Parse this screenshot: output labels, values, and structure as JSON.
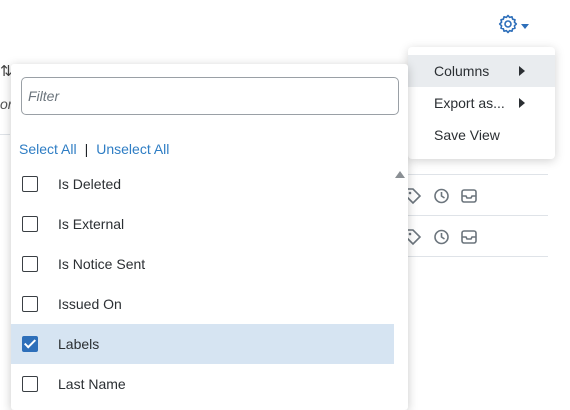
{
  "background": {
    "sort_icon": "⇅",
    "cut_text": "or"
  },
  "gear_button": {
    "icon": "gear-icon"
  },
  "settings_menu": {
    "items": [
      {
        "label": "Columns",
        "has_submenu": true,
        "active": true
      },
      {
        "label": "Export as...",
        "has_submenu": true,
        "active": false
      },
      {
        "label": "Save View",
        "has_submenu": false,
        "active": false
      }
    ]
  },
  "columns_panel": {
    "filter_placeholder": "Filter",
    "filter_value": "",
    "select_all_label": "Select All",
    "separator": "|",
    "unselect_all_label": "Unselect All",
    "columns": [
      {
        "label": "Is Deleted",
        "checked": false
      },
      {
        "label": "Is External",
        "checked": false
      },
      {
        "label": "Is Notice Sent",
        "checked": false
      },
      {
        "label": "Issued On",
        "checked": false
      },
      {
        "label": "Labels",
        "checked": true
      },
      {
        "label": "Last Name",
        "checked": false
      }
    ]
  },
  "colors": {
    "accent": "#2e6fba",
    "link": "#2e7dc4",
    "selected_row": "#d6e4f2"
  }
}
